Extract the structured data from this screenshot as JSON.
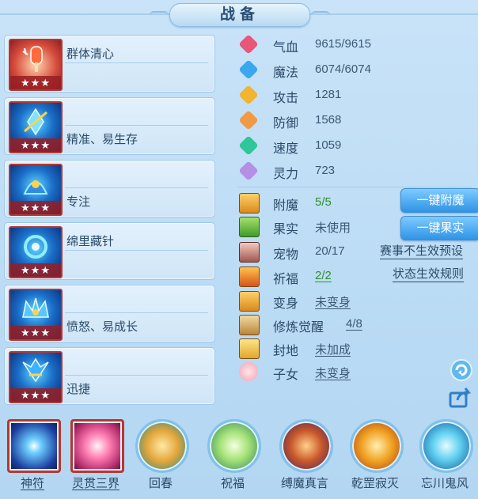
{
  "title": "战备",
  "skills": [
    {
      "label_top": "群体清心",
      "label_bottom": "",
      "stars": "★★★",
      "icon": "popsicle-icon"
    },
    {
      "label_top": "",
      "label_bottom": "精准、易生存",
      "stars": "★★★",
      "icon": "blue-blade-icon"
    },
    {
      "label_top": "",
      "label_bottom": "专注",
      "stars": "★★★",
      "icon": "blue-helm-icon"
    },
    {
      "label_top": "绵里藏针",
      "label_bottom": "",
      "stars": "★★★",
      "icon": "blue-ring-icon"
    },
    {
      "label_top": "",
      "label_bottom": "愤怒、易成长",
      "stars": "★★★",
      "icon": "blue-crown-icon"
    },
    {
      "label_top": "",
      "label_bottom": "迅捷",
      "stars": "★★★",
      "icon": "blue-wings-icon"
    }
  ],
  "stats": [
    {
      "name": "气血",
      "value": "9615/9615",
      "icon": "heart-icon",
      "color": "#e8567a"
    },
    {
      "name": "魔法",
      "value": "6074/6074",
      "icon": "droplet-icon",
      "color": "#3aa7ef"
    },
    {
      "name": "攻击",
      "value": "1281",
      "icon": "sword-icon",
      "color": "#f2b431"
    },
    {
      "name": "防御",
      "value": "1568",
      "icon": "shield-icon",
      "color": "#f29944"
    },
    {
      "name": "速度",
      "value": "1059",
      "icon": "lightning-icon",
      "color": "#2fc69a"
    },
    {
      "name": "灵力",
      "value": "723",
      "icon": "crystal-icon",
      "color": "#b58ee6"
    }
  ],
  "extras": [
    {
      "name": "附魔",
      "value": "5/5",
      "icon": "enchant-icon"
    },
    {
      "name": "果实",
      "value": "未使用",
      "icon": "fruit-icon"
    },
    {
      "name": "宠物",
      "value": "20/17",
      "icon": "pet-icon"
    },
    {
      "name": "祈福",
      "value": "2/2",
      "icon": "blessing-icon"
    },
    {
      "name": "变身",
      "value": "未变身",
      "icon": "transform-icon"
    },
    {
      "name": "修炼觉醒",
      "value": "4/8",
      "icon": "cultivation-icon"
    },
    {
      "name": "封地",
      "value": "未加成",
      "icon": "fief-icon"
    },
    {
      "name": "子女",
      "value": "未变身",
      "icon": "child-icon"
    }
  ],
  "buttons": {
    "enchant": "一键附魔",
    "fruit": "一键果实"
  },
  "links": {
    "preset": "赛事不生效预设",
    "rules": "状态生效规则"
  },
  "bottom": [
    {
      "label": "神符",
      "icon": "rune-icon"
    },
    {
      "label": "灵贯三界",
      "icon": "spirit-icon"
    },
    {
      "label": "回春",
      "icon": "rejuvenate-icon"
    },
    {
      "label": "祝福",
      "icon": "bless-icon"
    },
    {
      "label": "缚魔真言",
      "icon": "demon-bind-icon"
    },
    {
      "label": "乾罡寂灭",
      "icon": "annihilate-icon"
    },
    {
      "label": "忘川鬼风",
      "icon": "ghost-wind-icon"
    }
  ]
}
